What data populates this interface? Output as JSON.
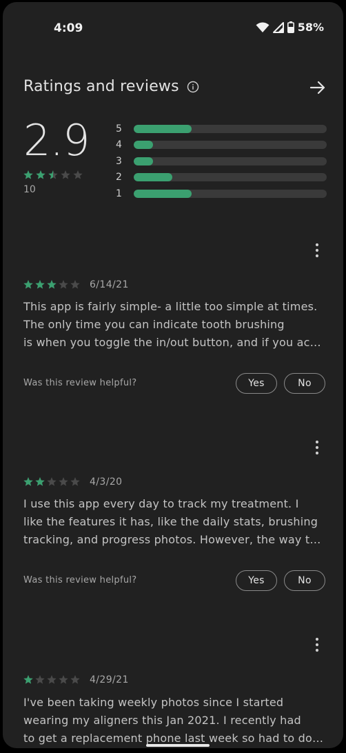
{
  "status": {
    "time": "4:09",
    "battery": "58%"
  },
  "header": {
    "title": "Ratings and reviews"
  },
  "summary": {
    "average": "2.9",
    "stars": 2.5,
    "count": "10"
  },
  "distribution": [
    {
      "label": "5",
      "fraction": 0.3
    },
    {
      "label": "4",
      "fraction": 0.1
    },
    {
      "label": "3",
      "fraction": 0.1
    },
    {
      "label": "2",
      "fraction": 0.2
    },
    {
      "label": "1",
      "fraction": 0.3
    }
  ],
  "reviews": [
    {
      "stars": 3,
      "date": "6/14/21",
      "lines": [
        "This app is fairly simple- a little too simple at times.",
        "The only time you can indicate tooth brushing",
        "is when you toggle the in/out button, and if you acc…"
      ],
      "helpful_question": "Was this review helpful?",
      "yes_label": "Yes",
      "no_label": "No"
    },
    {
      "stars": 2,
      "date": "4/3/20",
      "lines": [
        "I use this app every day to track my treatment. I",
        "like the features it has, like the daily stats, brushing",
        "tracking, and progress photos. However, the way th…"
      ],
      "helpful_question": "Was this review helpful?",
      "yes_label": "Yes",
      "no_label": "No"
    },
    {
      "stars": 1,
      "date": "4/29/21",
      "lines": [
        "I've been taking weekly photos since I started",
        "wearing my aligners this Jan 2021. I recently had",
        "to get a replacement phone last week so had to do…"
      ]
    }
  ],
  "colors": {
    "background": "#212121",
    "accent_green": "#3ba070",
    "star_filled": "#3ba070",
    "star_empty": "#4a4a4a",
    "text_primary": "#e3e3e3",
    "text_secondary": "#a8a8a8"
  },
  "icons": {
    "info": "info-icon",
    "arrow": "arrow-right-icon",
    "more": "more-vertical-icon",
    "wifi": "wifi-icon",
    "signal": "signal-icon",
    "battery": "battery-icon"
  }
}
